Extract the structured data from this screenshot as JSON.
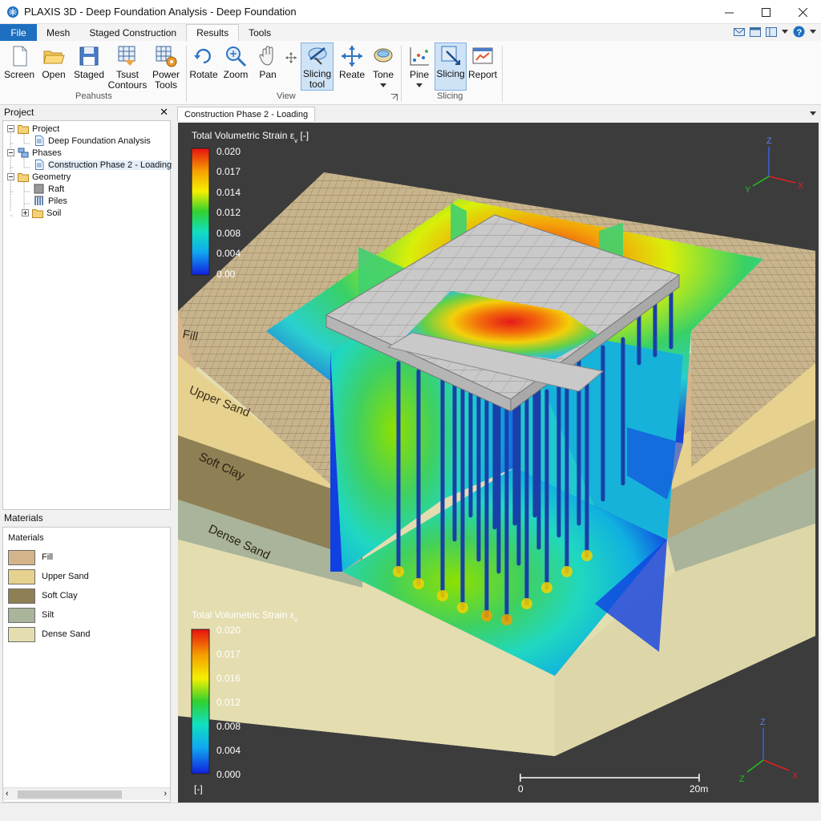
{
  "window": {
    "title": "PLAXIS 3D - Deep Foundation Analysis - Deep Foundation"
  },
  "menu_tabs": [
    "File",
    "Mesh",
    "Staged Construction",
    "Results",
    "Tools"
  ],
  "ribbon": {
    "buttons": {
      "screen": "Screen",
      "open": "Open",
      "staged": "Staged",
      "tsust1": "Tsust",
      "tsust2": "Contours",
      "power1": "Power",
      "power2": "Tools",
      "rotate": "Rotate",
      "zoom": "Zoom",
      "pan": "Pan",
      "slicing_tool1": "Slicing",
      "slicing_tool2": "tool",
      "reate": "Reate",
      "tone": "Tone",
      "pine": "Pine",
      "slicing": "Slicing",
      "report": "Report"
    },
    "groups": {
      "g1": "Peahusts",
      "g2": "View",
      "g3": "Slicing"
    }
  },
  "project_panel": {
    "title": "Project",
    "tree": {
      "project": "Project",
      "analysis": "Deep Foundation Analysis",
      "phases": "Phases",
      "phase2": "Construction Phase 2 - Loading",
      "geometry": "Geometry",
      "raft": "Raft",
      "piles": "Piles",
      "soil": "Soil"
    }
  },
  "materials_panel": {
    "title": "Materials",
    "header": "Materials",
    "items": [
      {
        "name": "Fill",
        "color": "#d4b48a"
      },
      {
        "name": "Upper Sand",
        "color": "#e6d18e"
      },
      {
        "name": "Soft Clay",
        "color": "#8f7f55"
      },
      {
        "name": "Silt",
        "color": "#a9b49a"
      },
      {
        "name": "Dense Sand",
        "color": "#e4ddb0"
      }
    ]
  },
  "document_tab": "Construction Phase 2 - Loading",
  "legend_top": {
    "title": "Total Volumetric Strain ε",
    "sub": "v",
    "unit": " [-]",
    "ticks": [
      "0.020",
      "0.017",
      "0.014",
      "0.012",
      "0.008",
      "0.004",
      "0.00"
    ]
  },
  "legend_bottom": {
    "title": "Total Volumetric Strain ε",
    "sub": "v",
    "ticks": [
      "0.020",
      "0.017",
      "0.016",
      "0.012",
      "0.008",
      "0.004",
      "0.000"
    ],
    "unit": "[-]"
  },
  "layer_labels": [
    "Fill",
    "Upper Sand",
    "Soft Clay",
    "Dense Sand"
  ],
  "scale_bar": {
    "start": "0",
    "end": "20m"
  },
  "axes": {
    "x": "X",
    "y": "Y",
    "z": "Z"
  },
  "colors": {
    "accent": "#1e6fc0",
    "viewport_bg": "#3c3c3c"
  }
}
